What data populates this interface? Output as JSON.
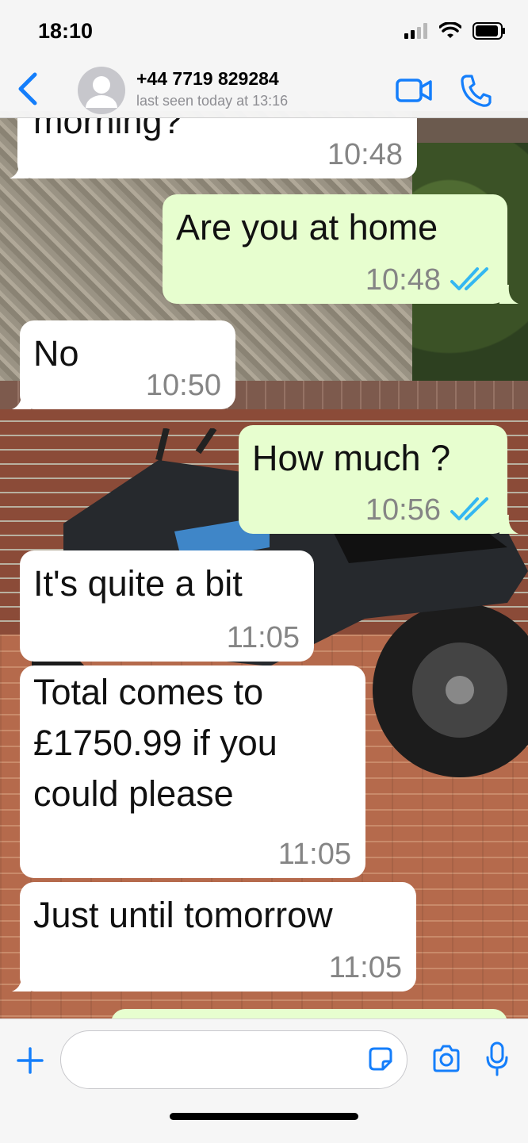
{
  "status_bar": {
    "time": "18:10",
    "icons": [
      "cellular-signal-icon",
      "wifi-icon",
      "battery-icon"
    ]
  },
  "header": {
    "contact_name": "+44 7719 829284",
    "last_seen": "last seen today at 13:16",
    "icons": [
      "back-chevron-icon",
      "avatar-icon",
      "video-call-icon",
      "phone-call-icon"
    ]
  },
  "messages": [
    {
      "direction": "incoming",
      "text": "morning?",
      "time": "10:48"
    },
    {
      "direction": "outgoing",
      "text": "Are you at home",
      "time": "10:48",
      "status": "read"
    },
    {
      "direction": "incoming",
      "text": "No",
      "time": "10:50"
    },
    {
      "direction": "outgoing",
      "text": "How much ?",
      "time": "10:56",
      "status": "read"
    },
    {
      "direction": "incoming",
      "text": "It's quite a bit",
      "time": "11:05"
    },
    {
      "direction": "incoming",
      "lines": [
        "Total comes to",
        "£1750.99 if you",
        "could please"
      ],
      "time": "11:05"
    },
    {
      "direction": "incoming",
      "text": "Just until tomorrow",
      "time": "11:05"
    }
  ],
  "composer": {
    "placeholder": "",
    "value": "",
    "icons": [
      "plus-icon",
      "sticker-icon",
      "camera-icon",
      "microphone-icon"
    ]
  },
  "colors": {
    "accent_blue": "#147efb",
    "incoming_bubble": "#ffffff",
    "outgoing_bubble": "#e7fecf",
    "read_ticks": "#34b7f1",
    "timestamp": "#858585"
  }
}
